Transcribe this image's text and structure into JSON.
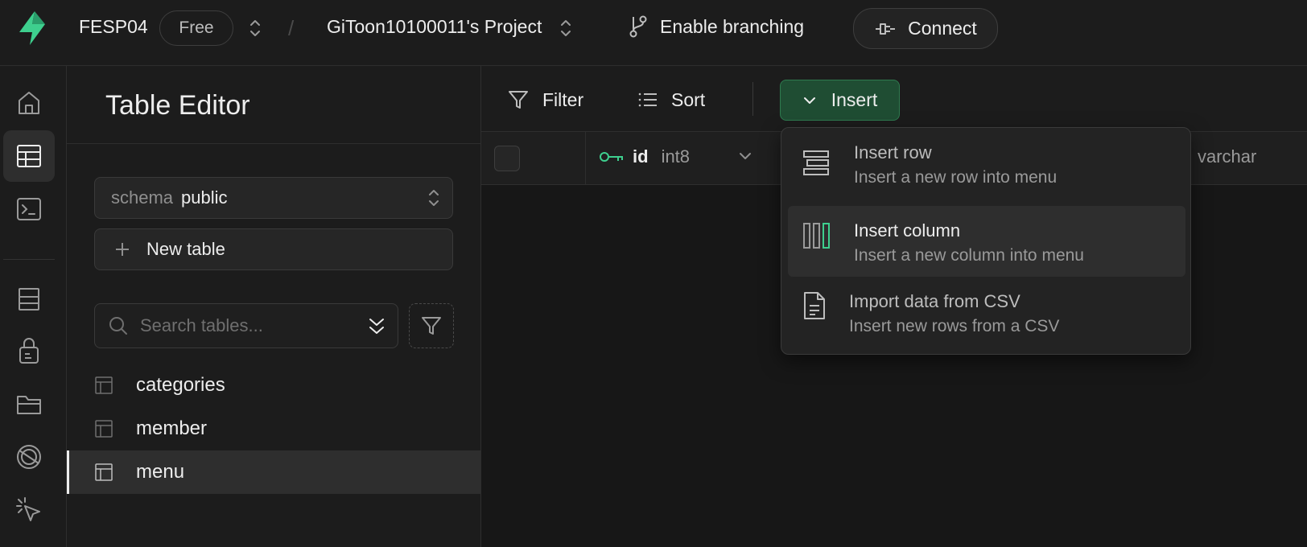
{
  "topbar": {
    "org_name": "FESP04",
    "plan_badge": "Free",
    "separator": "/",
    "project_name": "GiToon10100011's Project",
    "branching_label": "Enable branching",
    "connect_label": "Connect"
  },
  "sidebar": {
    "title": "Table Editor",
    "schema_label": "schema",
    "schema_value": "public",
    "new_table_label": "New table",
    "search_placeholder": "Search tables...",
    "tables": [
      {
        "name": "categories",
        "active": false
      },
      {
        "name": "member",
        "active": false
      },
      {
        "name": "menu",
        "active": true
      }
    ]
  },
  "toolbar": {
    "filter_label": "Filter",
    "sort_label": "Sort",
    "insert_label": "Insert"
  },
  "grid": {
    "columns": [
      {
        "name": "id",
        "type": "int8",
        "primary_key": true
      },
      {
        "name": "",
        "type": "varchar"
      }
    ]
  },
  "insert_menu": {
    "items": [
      {
        "title": "Insert row",
        "subtitle": "Insert a new row into menu",
        "icon": "rows-icon"
      },
      {
        "title": "Insert column",
        "subtitle": "Insert a new column into menu",
        "icon": "columns-icon",
        "highlighted": true
      },
      {
        "title": "Import data from CSV",
        "subtitle": "Insert new rows from a CSV",
        "icon": "file-text-icon"
      }
    ]
  },
  "colors": {
    "brand_green": "#3ecf8e",
    "insert_bg": "#1f4d33",
    "background": "#171717",
    "panel": "#1c1c1c"
  }
}
